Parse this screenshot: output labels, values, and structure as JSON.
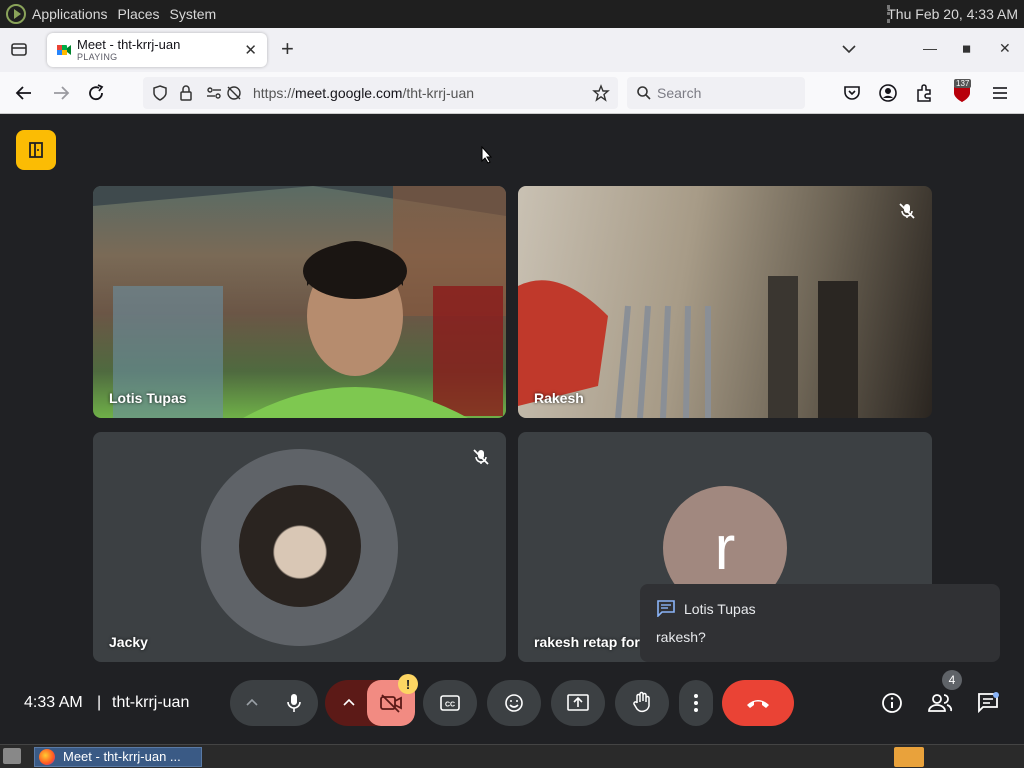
{
  "panel": {
    "menus": [
      "Applications",
      "Places",
      "System"
    ],
    "clock": "Thu Feb 20,  4:33 AM"
  },
  "browser": {
    "tab": {
      "title": "Meet - tht-krrj-uan",
      "subtitle": "PLAYING"
    },
    "url_prefix": "https://",
    "url_domain": "meet.google.com",
    "url_path": "/tht-krrj-uan",
    "search_placeholder": "Search",
    "extension_badge": "137"
  },
  "meet": {
    "participants": [
      {
        "name": "Lotis Tupas",
        "muted": false
      },
      {
        "name": "Rakesh",
        "muted": true
      },
      {
        "name": "Jacky",
        "muted": true
      },
      {
        "name": "rakesh retap for",
        "avatar_letter": "r",
        "muted": false
      }
    ],
    "chat_popup": {
      "sender": "Lotis Tupas",
      "message": "rakesh?"
    },
    "bottom_bar": {
      "time": "4:33 AM",
      "separator": "|",
      "meeting_code": "tht-krrj-uan",
      "camera_warning": "!",
      "people_count": "4"
    },
    "colors": {
      "leave": "#ea4335",
      "camera_off": "#f28b82",
      "exit_button": "#fbbc04"
    }
  },
  "taskbar": {
    "window_label": "Meet - tht-krrj-uan ..."
  }
}
